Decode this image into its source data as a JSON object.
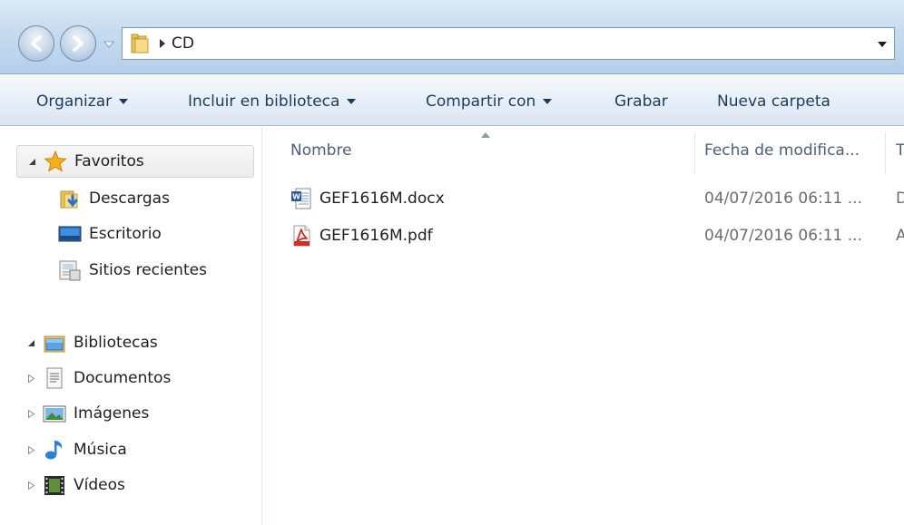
{
  "address": {
    "crumbs": [
      "CD"
    ]
  },
  "toolbar": {
    "organize": "Organizar",
    "include": "Incluir en biblioteca",
    "share": "Compartir con",
    "burn": "Grabar",
    "new_folder": "Nueva carpeta"
  },
  "navigation": {
    "favorites": {
      "label": "Favoritos",
      "items": [
        {
          "label": "Descargas",
          "icon": "downloads-folder-icon"
        },
        {
          "label": "Escritorio",
          "icon": "desktop-icon"
        },
        {
          "label": "Sitios recientes",
          "icon": "recent-places-icon"
        }
      ]
    },
    "libraries": {
      "label": "Bibliotecas",
      "items": [
        {
          "label": "Documentos",
          "icon": "documents-library-icon"
        },
        {
          "label": "Imágenes",
          "icon": "pictures-library-icon"
        },
        {
          "label": "Música",
          "icon": "music-library-icon"
        },
        {
          "label": "Vídeos",
          "icon": "videos-library-icon"
        }
      ]
    }
  },
  "columns": {
    "name": "Nombre",
    "date": "Fecha de modifica...",
    "type": "T"
  },
  "files": [
    {
      "name": "GEF1616M.docx",
      "date": "04/07/2016 06:11 ...",
      "type": "D",
      "icon": "word-document-icon"
    },
    {
      "name": "GEF1616M.pdf",
      "date": "04/07/2016 06:11 ...",
      "type": "A",
      "icon": "pdf-document-icon"
    }
  ],
  "colors": {
    "command_text": "#1e3b5c",
    "header_text": "#4c607a",
    "pdf_red": "#d42c20",
    "word_blue": "#2b5797",
    "star_gold": "#f2b01e"
  }
}
